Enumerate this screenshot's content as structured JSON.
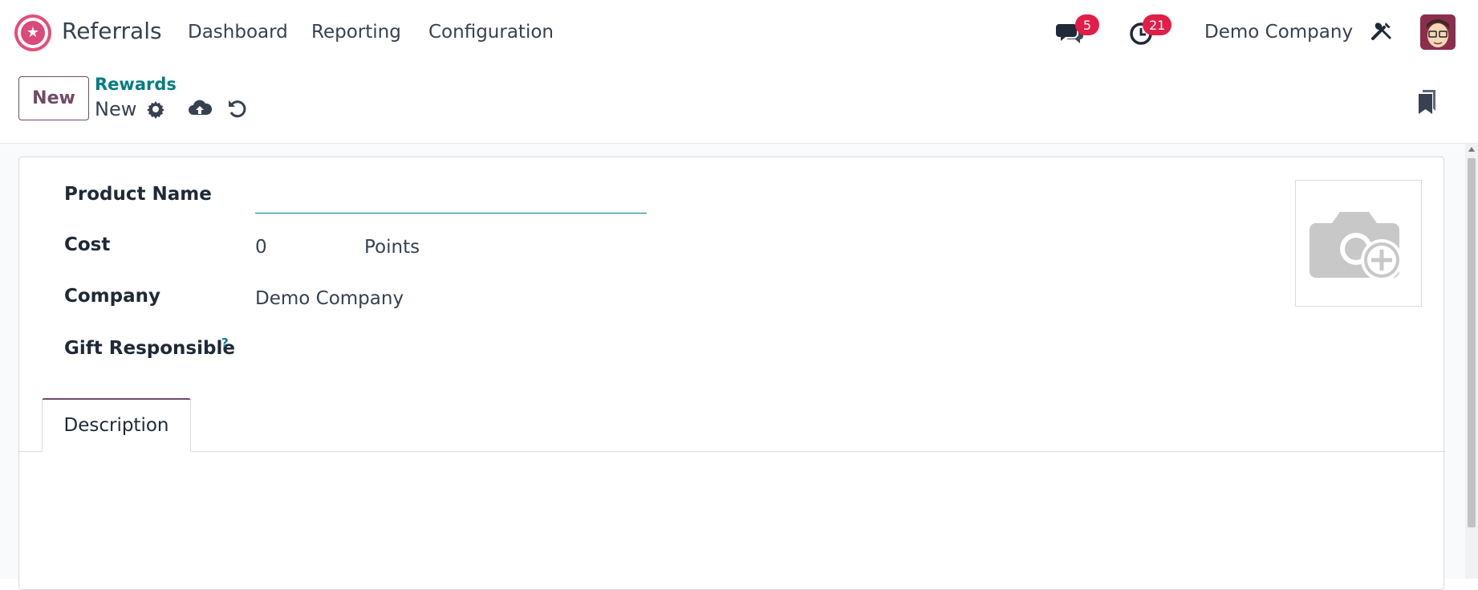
{
  "navbar": {
    "app_name": "Referrals",
    "menu": [
      "Dashboard",
      "Reporting",
      "Configuration"
    ],
    "messages_count": "5",
    "activities_count": "21",
    "company": "Demo Company"
  },
  "control_panel": {
    "new_label": "New",
    "breadcrumb_parent": "Rewards",
    "breadcrumb_current": "New"
  },
  "form": {
    "product_name_label": "Product Name",
    "product_name_value": "",
    "cost_label": "Cost",
    "cost_value": "0",
    "cost_unit": "Points",
    "company_label": "Company",
    "company_value": "Demo Company",
    "gift_responsible_label": "Gift Responsible",
    "help_mark": "?"
  },
  "tabs": [
    "Description"
  ],
  "colors": {
    "brand": "#714b67",
    "link": "#017e84",
    "badge": "#e11d48"
  }
}
